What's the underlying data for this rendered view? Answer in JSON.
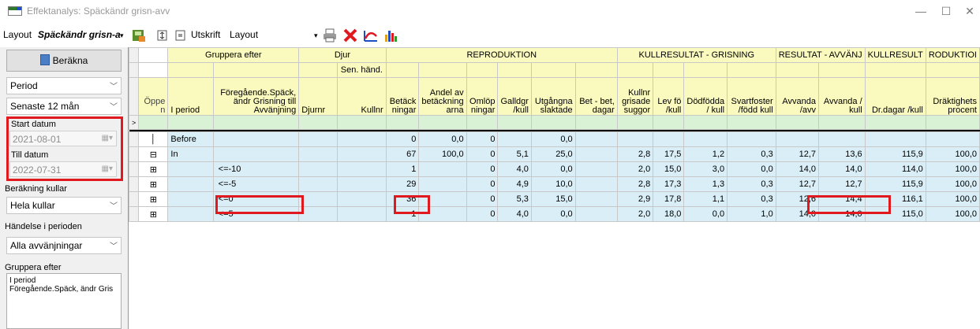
{
  "window": {
    "title": "Effektanalys: Späckändr grisn-avv"
  },
  "toolbar": {
    "layout_label": "Layout",
    "layout_name": "Späckändr grisn-a",
    "print_label": "Utskrift",
    "layout_dropdown": "Layout"
  },
  "left": {
    "calc_button": "Beräkna",
    "period_combo": "Period",
    "period_value": "Senaste 12 mån",
    "start_label": "Start datum",
    "start_value": "2021-08-01",
    "end_label": "Till datum",
    "end_value": "2022-07-31",
    "kullar_label": "Beräkning kullar",
    "kullar_value": "Hela kullar",
    "handelse_label": "Händelse i perioden",
    "handelse_value": "Alla avvänjningar",
    "gruppera_label": "Gruppera efter",
    "gruppera_items": [
      "I period",
      "Föregående.Späck, ändr Gris"
    ]
  },
  "grid": {
    "groups": {
      "gruppera": "Gruppera efter",
      "djur": "Djur",
      "reproduktion": "REPRODUKTION",
      "kull_grisning": "KULLRESULTAT - GRISNING",
      "res_avvanj": "RESULTAT - AVVÄNJ",
      "kullresult": "KULLRESULT",
      "produktion": "RODUKTIOI"
    },
    "subgroup": {
      "sen_hand": "Sen. händ."
    },
    "columns": {
      "oppen": "Öppe n",
      "i_period": "I period",
      "foregaende": "Föregående.Späck, ändr Grisning till Avvänjning",
      "djurnr": "Djurnr",
      "kullnr": "Kullnr",
      "betackningar": "Betäck ningar",
      "andel_av": "Andel av betäckning arna",
      "omlopningar": "Omlöp ningar",
      "galldgr": "Galldgr /kull",
      "utgangna": "Utgångna slaktade",
      "bet_bet": "Bet - bet, dagar",
      "kullnr_grisade": "Kullnr grisade suggor",
      "lev_fo": "Lev fö /kull",
      "dodfodda": "Dödfödda / kull",
      "svartfoster": "Svartfoster /född kull",
      "avvanda_avv": "Avvanda /avv",
      "avvanda_kull": "Avvanda / kull",
      "drdagar": "Dr.dagar /kull",
      "drakt": "Dräktighets procent"
    },
    "rows": [
      {
        "iperiod": "Before",
        "fore": "",
        "bet": "0",
        "andel": "0,0",
        "oml": "0",
        "gall": "",
        "utg": "0,0",
        "betbet": "",
        "kn": "",
        "lev": "",
        "dod": "",
        "svart": "",
        "avv1": "",
        "avv2": "",
        "dr": "",
        "drakt": ""
      },
      {
        "iperiod": "In",
        "fore": "",
        "bet": "67",
        "andel": "100,0",
        "oml": "0",
        "gall": "5,1",
        "utg": "25,0",
        "betbet": "",
        "kn": "2,8",
        "lev": "17,5",
        "dod": "1,2",
        "svart": "0,3",
        "avv1": "12,7",
        "avv2": "13,6",
        "dr": "115,9",
        "drakt": "100,0"
      },
      {
        "iperiod": "",
        "fore": "<=-10",
        "bet": "1",
        "andel": "",
        "oml": "0",
        "gall": "4,0",
        "utg": "0,0",
        "betbet": "",
        "kn": "2,0",
        "lev": "15,0",
        "dod": "3,0",
        "svart": "0,0",
        "avv1": "14,0",
        "avv2": "14,0",
        "dr": "114,0",
        "drakt": "100,0"
      },
      {
        "iperiod": "",
        "fore": "<=-5",
        "bet": "29",
        "andel": "",
        "oml": "0",
        "gall": "4,9",
        "utg": "10,0",
        "betbet": "",
        "kn": "2,8",
        "lev": "17,3",
        "dod": "1,3",
        "svart": "0,3",
        "avv1": "12,7",
        "avv2": "12,7",
        "dr": "115,9",
        "drakt": "100,0"
      },
      {
        "iperiod": "",
        "fore": "<=0",
        "bet": "36",
        "andel": "",
        "oml": "0",
        "gall": "5,3",
        "utg": "15,0",
        "betbet": "",
        "kn": "2,9",
        "lev": "17,8",
        "dod": "1,1",
        "svart": "0,3",
        "avv1": "12,6",
        "avv2": "14,4",
        "dr": "116,1",
        "drakt": "100,0"
      },
      {
        "iperiod": "",
        "fore": "<=5",
        "bet": "1",
        "andel": "",
        "oml": "0",
        "gall": "4,0",
        "utg": "0,0",
        "betbet": "",
        "kn": "2,0",
        "lev": "18,0",
        "dod": "0,0",
        "svart": "1,0",
        "avv1": "14,0",
        "avv2": "14,0",
        "dr": "115,0",
        "drakt": "100,0"
      }
    ]
  }
}
